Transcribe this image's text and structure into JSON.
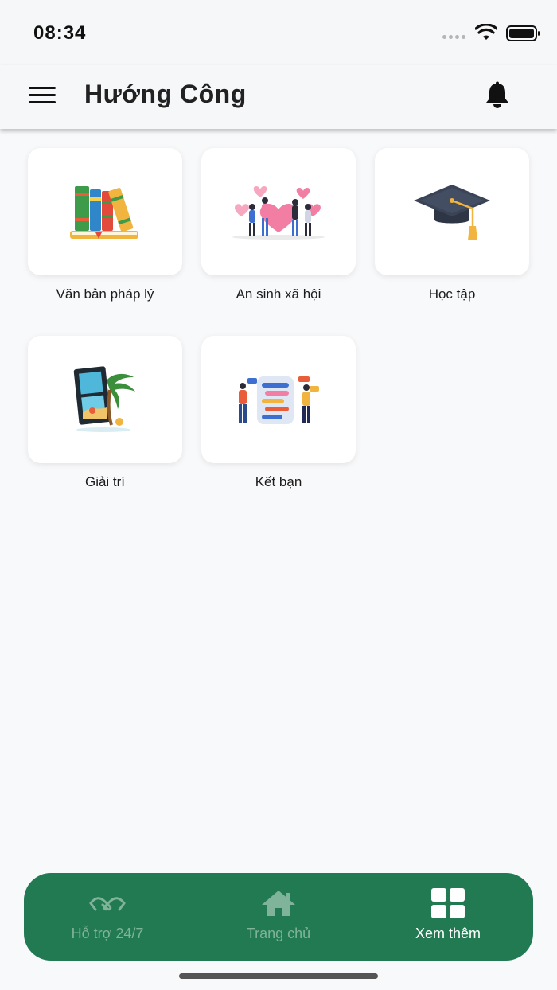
{
  "status_bar": {
    "time": "08:34"
  },
  "header": {
    "title": "Hướng Công",
    "menu_icon": "hamburger-menu-icon",
    "notification_icon": "bell-icon"
  },
  "tiles": [
    {
      "label": "Văn bản pháp lý",
      "icon": "books-icon"
    },
    {
      "label": "An sinh xã hội",
      "icon": "people-hearts-icon"
    },
    {
      "label": "Học tập",
      "icon": "graduation-cap-icon"
    },
    {
      "label": "Giải trí",
      "icon": "film-beach-icon"
    },
    {
      "label": "Kết bạn",
      "icon": "chat-friends-icon"
    }
  ],
  "bottom_nav": {
    "items": [
      {
        "label": "Hỗ trợ 24/7",
        "icon": "handshake-icon",
        "active": false
      },
      {
        "label": "Trang chủ",
        "icon": "home-icon",
        "active": false
      },
      {
        "label": "Xem thêm",
        "icon": "grid-icon",
        "active": true
      }
    ]
  },
  "colors": {
    "nav_background": "#217a52",
    "active_label": "#ffffff",
    "inactive_label": "#7fb39a",
    "page_background": "#f8f9fb"
  }
}
